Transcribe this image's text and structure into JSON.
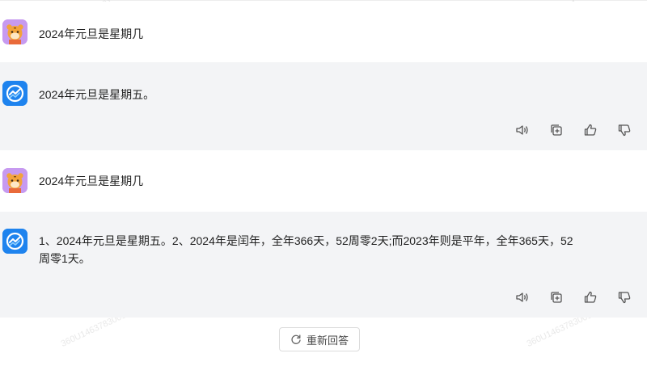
{
  "conversation": [
    {
      "role": "user",
      "text": "2024年元旦是星期几"
    },
    {
      "role": "assistant",
      "text": "2024年元旦是星期五。"
    },
    {
      "role": "user",
      "text": "2024年元旦是星期几"
    },
    {
      "role": "assistant",
      "text": "1、2024年元旦是星期五。2、2024年是闰年，全年366天，52周零2天;而2023年则是平年，全年365天，52\n周零1天。"
    }
  ],
  "actions": {
    "icons": [
      "speaker-icon",
      "copy-icon",
      "thumbs-up-icon",
      "thumbs-down-icon"
    ]
  },
  "regenerate": {
    "label": "重新回答",
    "icon": "refresh-icon"
  },
  "watermarks": {
    "id": "1463783001",
    "id_full": "360U1463783001"
  },
  "colors": {
    "user_avatar_bg": "#c79af0",
    "bot_avatar_bg": "#1e83ee",
    "bot_row_bg": "#f3f4f6"
  }
}
